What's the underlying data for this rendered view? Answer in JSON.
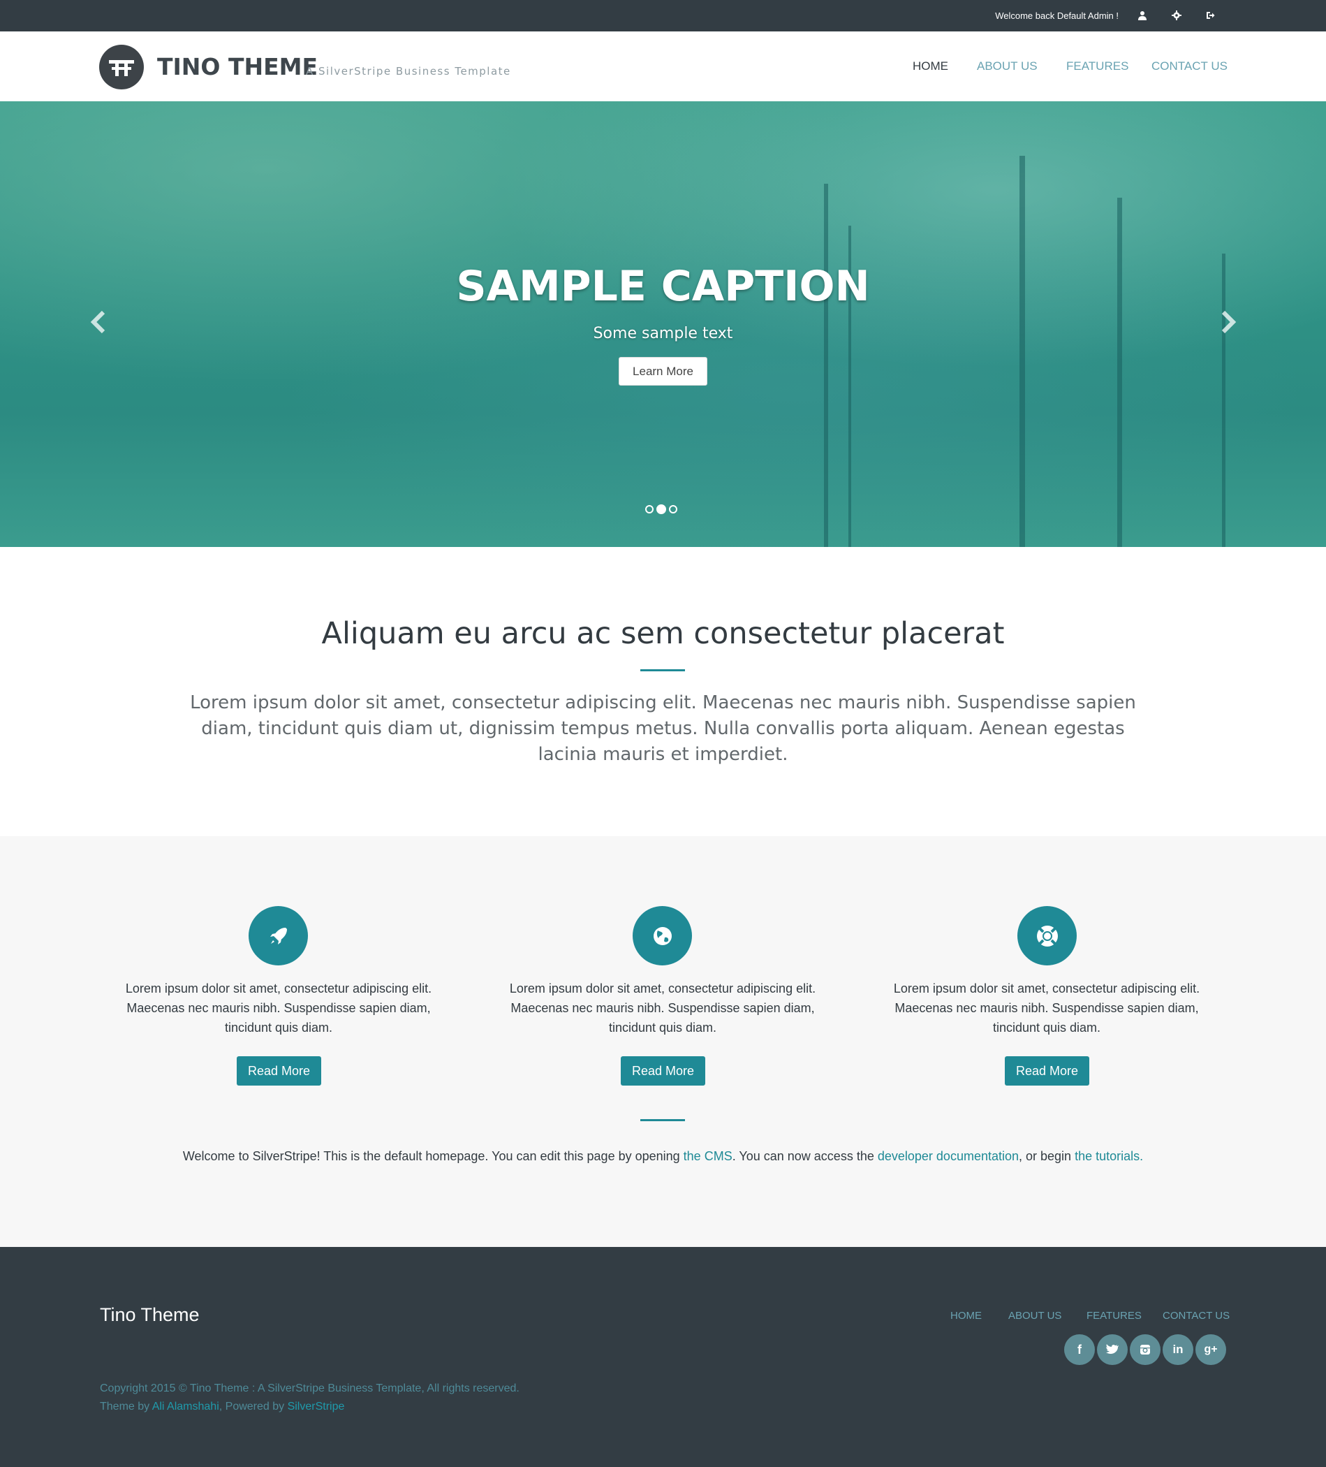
{
  "topbar": {
    "welcome": "Welcome back Default Admin !",
    "icons": [
      "user-icon",
      "gear-icon",
      "sign-out-icon"
    ]
  },
  "header": {
    "brand": "TINO THEME",
    "tagline": "A SilverStripe Business Template",
    "nav": [
      "HOME",
      "ABOUT US",
      "FEATURES",
      "CONTACT US"
    ],
    "active": "HOME"
  },
  "hero": {
    "caption": "SAMPLE CAPTION",
    "text": "Some sample text",
    "button": "Learn More",
    "slides": 3,
    "active_slide": 2
  },
  "intro": {
    "title": "Aliquam eu arcu ac sem consectetur placerat",
    "text": "Lorem ipsum dolor sit amet, consectetur adipiscing elit. Maecenas nec mauris nibh. Suspendisse sapien diam, tincidunt quis diam ut, dignissim tempus metus. Nulla convallis porta aliquam. Aenean egestas lacinia mauris et imperdiet."
  },
  "features": [
    {
      "icon": "rocket-icon",
      "text": "Lorem ipsum dolor sit amet, consectetur adipiscing elit. Maecenas nec mauris nibh. Suspendisse sapien diam, tincidunt quis diam.",
      "button": "Read More"
    },
    {
      "icon": "globe-icon",
      "text": "Lorem ipsum dolor sit amet, consectetur adipiscing elit. Maecenas nec mauris nibh. Suspendisse sapien diam, tincidunt quis diam.",
      "button": "Read More"
    },
    {
      "icon": "lifebuoy-icon",
      "text": "Lorem ipsum dolor sit amet, consectetur adipiscing elit. Maecenas nec mauris nibh. Suspendisse sapien diam, tincidunt quis diam.",
      "button": "Read More"
    }
  ],
  "welcome": {
    "part1": "Welcome to SilverStripe! This is the default homepage. You can edit this page by opening ",
    "link1": "the CMS",
    "part2": ". You can now access the ",
    "link2": "developer documentation",
    "part3": ", or begin ",
    "link3": "the tutorials."
  },
  "footer": {
    "title": "Tino Theme",
    "nav": [
      "HOME",
      "ABOUT US",
      "FEATURES",
      "CONTACT US"
    ],
    "social": [
      "facebook-icon",
      "twitter-icon",
      "instagram-icon",
      "linkedin-icon",
      "google-plus-icon"
    ],
    "copyright": "Copyright 2015 © Tino Theme : A SilverStripe Business Template, All rights reserved.",
    "theme_by": "Theme by ",
    "author": "Ali Alamshahi",
    "powered_by": ", Powered by ",
    "powered_link": "SilverStripe"
  },
  "colors": {
    "accent": "#1f8a96",
    "dark": "#333d44",
    "link": "#6aa3b2"
  }
}
